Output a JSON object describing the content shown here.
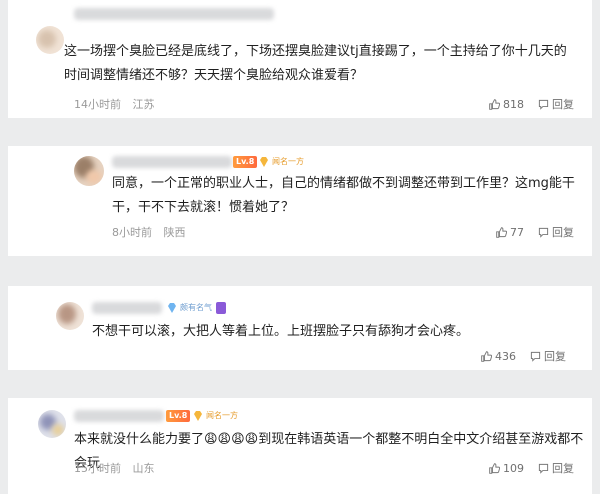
{
  "comments": [
    {
      "text": "这一场摆个臭脸已经是底线了，下场还摆臭脸建议tj直接踢了，一个主持给了你十几天的时间调整情绪还不够？天天摆个臭脸给观众谁爱看？",
      "time": "14小时前",
      "location": "江苏",
      "likes": "818",
      "reply_label": "回复"
    },
    {
      "badge_level": "Lv.8",
      "badge_title": "闻名一方",
      "text": "同意，一个正常的职业人士，自己的情绪都做不到调整还带到工作里？这mg能干干，干不下去就滚！惯着她了？",
      "time": "8小时前",
      "location": "陕西",
      "likes": "77",
      "reply_label": "回复"
    },
    {
      "badge_title": "颇有名气",
      "text": "不想干可以滚，大把人等着上位。上班摆脸子只有舔狗才会心疼。",
      "likes": "436",
      "reply_label": "回复"
    },
    {
      "badge_level": "Lv.8",
      "badge_title": "闻名一方",
      "text": "本来就没什么能力要了😩😩😩😩到现在韩语英语一个都整不明白全中文介绍甚至游戏都不会玩",
      "time": "15小时前",
      "location": "山东",
      "likes": "109",
      "reply_label": "回复"
    }
  ],
  "icons": {
    "like": "thumbs-up-icon",
    "reply": "comment-bubble-icon",
    "badge": "diamond-gem-icon"
  },
  "colors": {
    "background": "#ebeced",
    "card": "#ffffff",
    "text": "#1f1f1f",
    "meta": "#9a9a9a",
    "badge_gold": "#e69b2a"
  }
}
